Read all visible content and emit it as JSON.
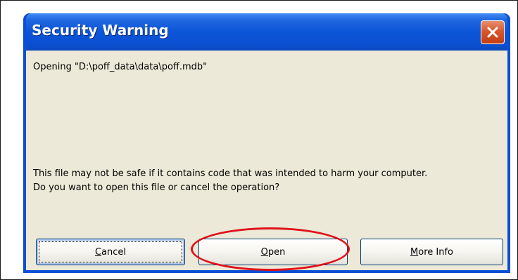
{
  "dialog": {
    "title": "Security Warning",
    "close_icon": "close-icon",
    "opening_message": "Opening \"D:\\poff_data\\data\\poff.mdb\"",
    "warning_line1": "This file may not be safe if it contains code that was intended to harm your computer.",
    "warning_line2": "Do you want to open this file or cancel the operation?"
  },
  "buttons": {
    "cancel": {
      "mnemonic": "C",
      "rest": "ancel"
    },
    "open": {
      "mnemonic": "O",
      "rest": "pen"
    },
    "more_info": {
      "pre": "",
      "mnemonic": "M",
      "rest": "ore Info"
    }
  },
  "colors": {
    "title_bar": "#0a4fd4",
    "dialog_background": "#ece9d8",
    "close_button": "#d9562d",
    "highlight": "#e0111a"
  }
}
